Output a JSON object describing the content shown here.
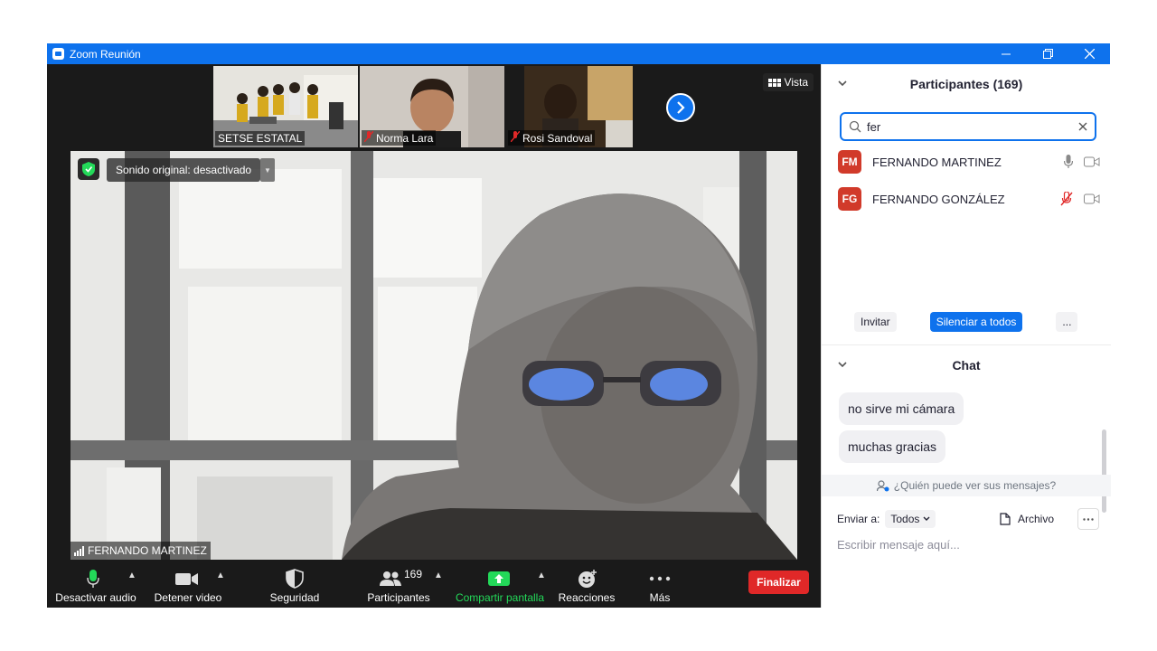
{
  "window": {
    "title": "Zoom Reunión"
  },
  "gallery": {
    "thumbnails": [
      {
        "name": "SETSE ESTATAL",
        "muted": false
      },
      {
        "name": "Norma Lara",
        "muted": true
      },
      {
        "name": "Rosi Sandoval",
        "muted": true
      }
    ],
    "view_label": "Vista"
  },
  "main_video": {
    "sound_label": "Sonido original: desactivado",
    "speaker_name": "FERNANDO MARTINEZ"
  },
  "toolbar": {
    "mute_label": "Desactivar audio",
    "video_label": "Detener video",
    "security_label": "Seguridad",
    "participants_label": "Participantes",
    "participants_count": "169",
    "share_label": "Compartir pantalla",
    "reactions_label": "Reacciones",
    "more_label": "Más",
    "end_label": "Finalizar"
  },
  "participants": {
    "title": "Participantes (169)",
    "search_value": "fer",
    "list": [
      {
        "initials": "FM",
        "name": "FERNANDO MARTINEZ",
        "mic": "on"
      },
      {
        "initials": "FG",
        "name": "FERNANDO GONZÁLEZ",
        "mic": "muted"
      }
    ],
    "invite_label": "Invitar",
    "mute_all_label": "Silenciar a todos",
    "more_label": "..."
  },
  "chat": {
    "title": "Chat",
    "messages": [
      "no sirve mi cámara",
      "muchas gracias"
    ],
    "who_can_see": "¿Quién puede ver sus mensajes?",
    "send_to_label": "Enviar a:",
    "send_to_value": "Todos",
    "file_label": "Archivo",
    "placeholder": "Escribir mensaje aquí..."
  },
  "colors": {
    "accent": "#0e72ed",
    "danger": "#e02828",
    "share_green": "#23d959",
    "avatar": "#d13a2a"
  }
}
